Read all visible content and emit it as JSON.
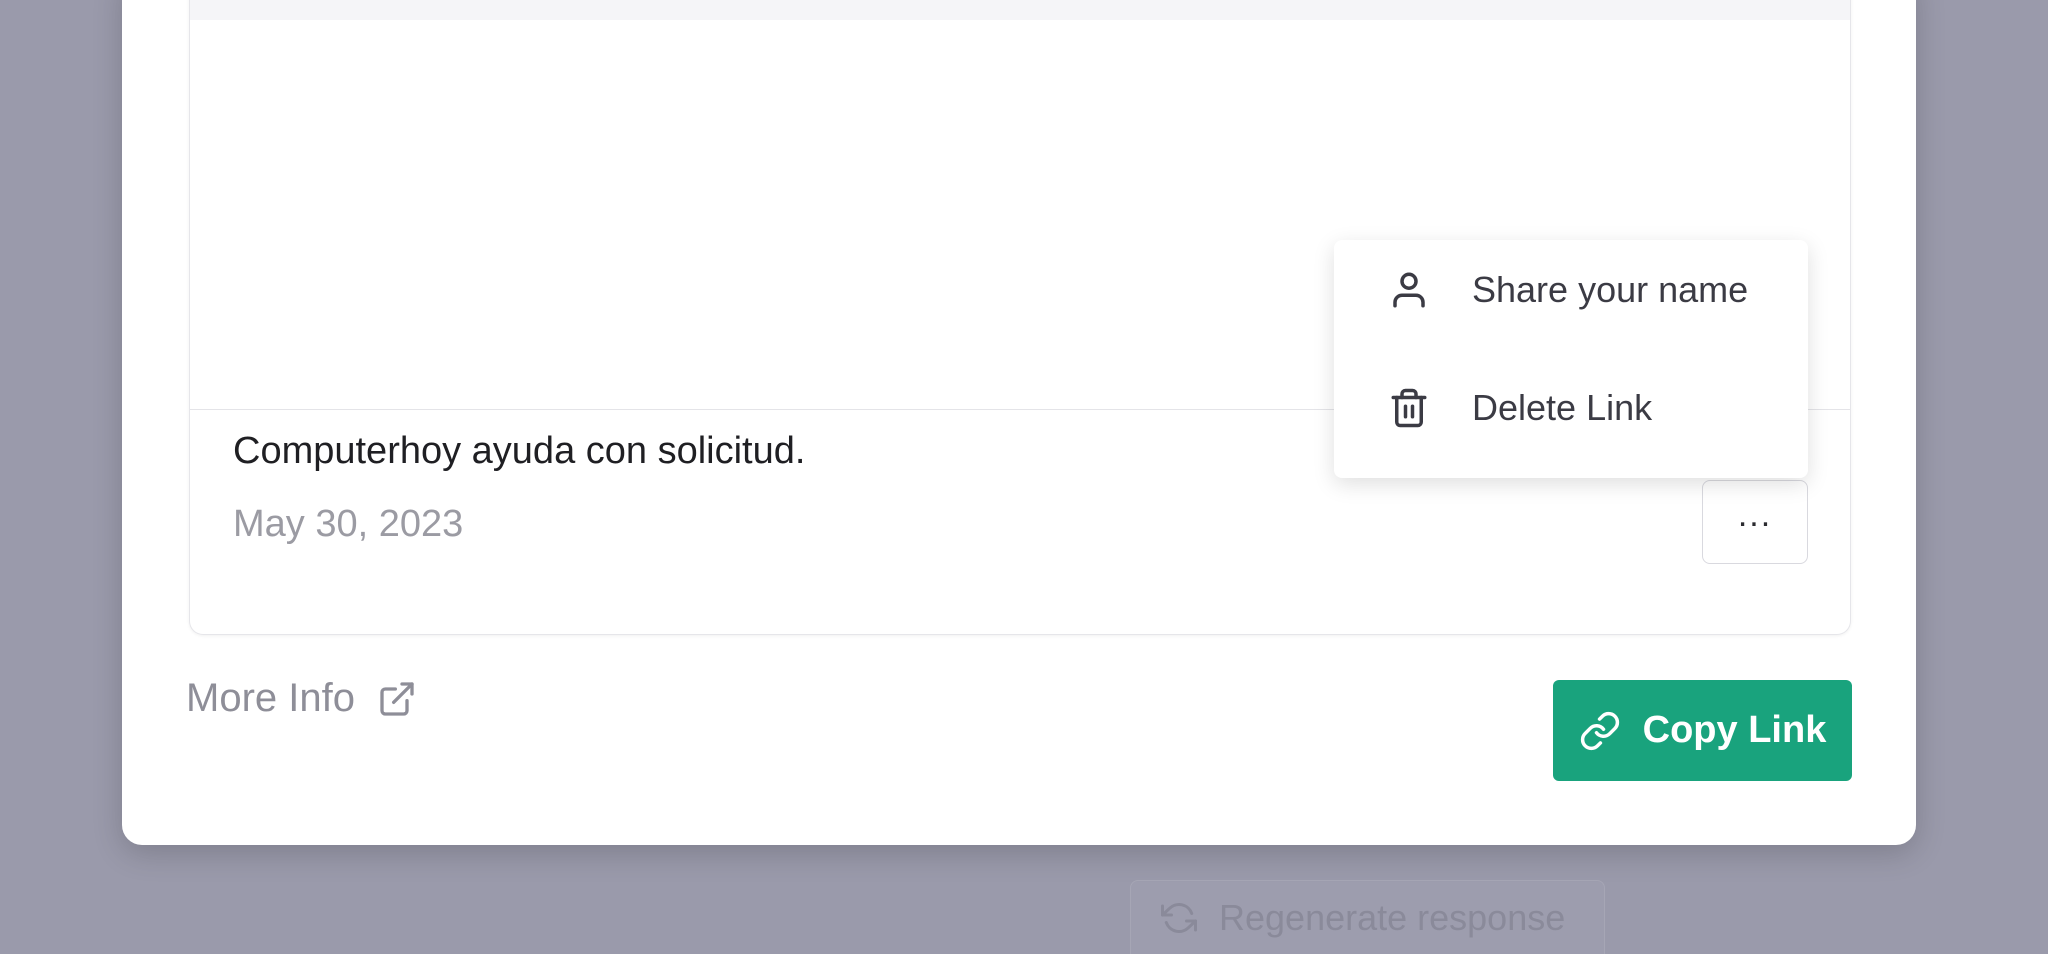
{
  "background_button": {
    "label": "Regenerate response"
  },
  "share_card": {
    "title": "Computerhoy ayuda con solicitud.",
    "date": "May 30, 2023",
    "more_button_label": "..."
  },
  "dropdown_menu": {
    "items": [
      {
        "label": "Share your name",
        "icon": "user-icon"
      },
      {
        "label": "Delete Link",
        "icon": "trash-icon"
      }
    ]
  },
  "footer": {
    "more_info_label": "More Info",
    "copy_link_label": "Copy Link"
  },
  "colors": {
    "accent": "#19a37d",
    "overlay": "#9a9aab",
    "muted_text": "#9b9ba3"
  }
}
